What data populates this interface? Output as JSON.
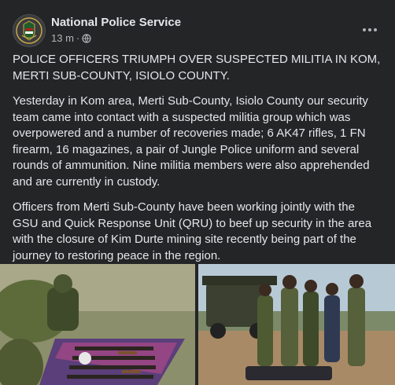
{
  "post": {
    "page_name": "National Police Service",
    "time": "13 m",
    "separator": "·",
    "privacy_icon": "globe-icon",
    "paragraphs": [
      "POLICE OFFICERS TRIUMPH OVER SUSPECTED MILITIA IN KOM, MERTI SUB-COUNTY, ISIOLO COUNTY.",
      "Yesterday in Kom area, Merti Sub-County, Isiolo County our security team came into contact with a suspected militia group which was overpowered and a number of recoveries made; 6 AK47 rifles, 1 FN firearm, 16 magazines, a pair of Jungle Police uniform and several rounds of ammunition. Nine militia members were also apprehended and are currently in custody.",
      "Officers from Merti Sub-County have been working jointly with the GSU and Quick Response Unit (QRU) to beef up security in the area with the closure of Kim Durte mining site recently being part of the journey to restoring peace in the region."
    ]
  },
  "colors": {
    "background": "#242526",
    "primary_text": "#e4e6eb",
    "secondary_text": "#b0b3b8"
  }
}
